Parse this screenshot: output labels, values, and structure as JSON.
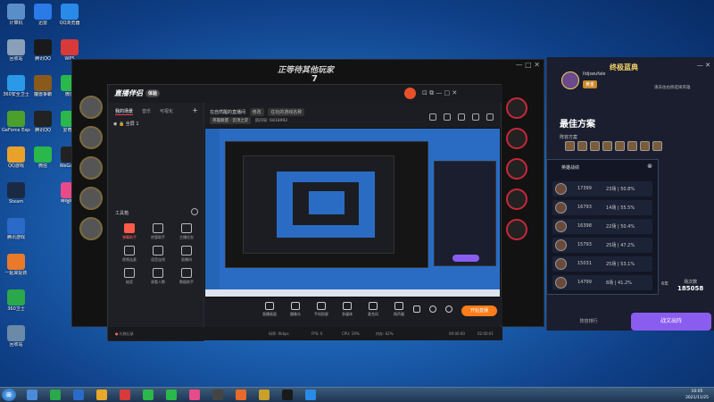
{
  "desktop": {
    "icons": [
      {
        "label": "计算机",
        "color": "#5a8ec8"
      },
      {
        "label": "回收站",
        "color": "#8aa0b8"
      },
      {
        "label": "360安全卫士",
        "color": "#2a9ae8"
      },
      {
        "label": "GeForce Experience",
        "color": "#4aa02a"
      },
      {
        "label": "QQ游戏",
        "color": "#e8a22a"
      },
      {
        "label": "Steam",
        "color": "#1a2a44"
      },
      {
        "label": "腾讯游戏",
        "color": "#2a6ac8"
      },
      {
        "label": "一起来捉妖",
        "color": "#e87a2a"
      },
      {
        "label": "360卫士",
        "color": "#2aa84a"
      },
      {
        "label": "回收站",
        "color": "#6a8aa8"
      },
      {
        "label": "迅雷",
        "color": "#2a7ae8"
      },
      {
        "label": "腾讯QQ",
        "color": "#1a1a1a"
      },
      {
        "label": "魔兽争霸",
        "color": "#8a5a1a"
      },
      {
        "label": "腾讯QQ",
        "color": "#222"
      },
      {
        "label": "微信",
        "color": "#2ab84a"
      },
      {
        "label": "QQ浏览器",
        "color": "#2a8ae8"
      },
      {
        "label": "WPS",
        "color": "#d83a3a"
      },
      {
        "label": "微信",
        "color": "#2ab84a"
      },
      {
        "label": "爱奇艺",
        "color": "#2ab84a"
      },
      {
        "label": "WeGame",
        "color": "#222"
      },
      {
        "label": "哔哩哔哩",
        "color": "#e84a8a"
      }
    ]
  },
  "game_client": {
    "title": "正等待其他玩家",
    "number": "7",
    "window_controls": "— □ ✕"
  },
  "app": {
    "brand": "直播伴侣",
    "version_pill": "体验",
    "window_controls": "⊡  ⧉  —  □  ✕",
    "tabs": [
      "我的场景",
      "音乐",
      "可视化"
    ],
    "scene_label": "全屏 1",
    "tools_title": "工具箱",
    "tools": [
      {
        "label": "弹幕助手",
        "active": true
      },
      {
        "label": "房管助手",
        "active": false
      },
      {
        "label": "主播任务",
        "active": false
      },
      {
        "label": "视频连麦",
        "active": false
      },
      {
        "label": "语音连线",
        "active": false
      },
      {
        "label": "直播间",
        "active": false
      },
      {
        "label": "抽奖",
        "active": false
      },
      {
        "label": "观看人数",
        "active": false
      },
      {
        "label": "数据助手",
        "active": false
      }
    ],
    "room_title": "在自然醒的直播间",
    "room_tag_edit": "修改",
    "room_desc": "在玩的游戏名称",
    "room_tag1": "英雄联盟 · 云顶之弈",
    "room_id": "房间号: 6818992",
    "bottom_items": [
      "直播画面",
      "摄像头",
      "手机投屏",
      "多媒体",
      "麦克风",
      "扬声器"
    ],
    "go_live": "开始直播",
    "status": "礼物记录",
    "status_bitrate": "码率: 0kbps",
    "status_fps": "FPS: 0",
    "status_cpu": "CPU: 19%",
    "status_mem": "内存: 62%",
    "time1": "00:00:00",
    "time2": "02:00:01"
  },
  "right_panel": {
    "title": "终极蓝典",
    "username": "lldjseufale",
    "level_tag": "黄金",
    "best_title": "最佳方案",
    "sub_label": "阵容方案",
    "note": "请去往右侧选择英雄",
    "btn_primary": "战文出阵",
    "btn_secondary": "阵容排行",
    "stat_label": "场次数",
    "stat_value": "185058",
    "stat_prefix": "6年"
  },
  "popup": {
    "title": "英雄战绩",
    "rows": [
      {
        "rank": "17399",
        "win": "23场 | 50.8%"
      },
      {
        "rank": "16793",
        "win": "14场 | 55.5%"
      },
      {
        "rank": "16398",
        "win": "22场 | 50.4%"
      },
      {
        "rank": "15793",
        "win": "25场 | 47.2%"
      },
      {
        "rank": "15031",
        "win": "25场 | 53.1%"
      },
      {
        "rank": "14799",
        "win": "8场 | 41.2%"
      }
    ]
  },
  "taskbar": {
    "clock_time": "10:05",
    "clock_date": "2021/11/25",
    "start_icon": "windows-start-icon"
  }
}
